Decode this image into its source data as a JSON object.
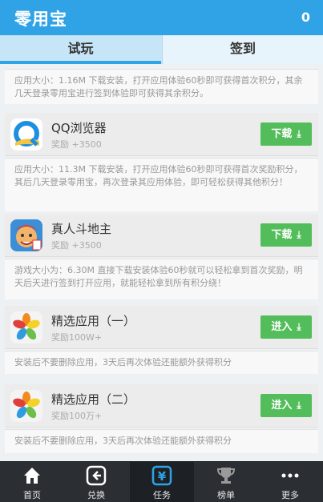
{
  "header": {
    "title": "零用宝",
    "count": "0"
  },
  "tabs": [
    {
      "label": "试玩"
    },
    {
      "label": "签到"
    }
  ],
  "top_desc": "应用大小：1.16M 下载安装，打开应用体验60秒即可获得首次积分，其余几天登录零用宝进行签到体验即可获得其余积分。",
  "apps": [
    {
      "name": "QQ浏览器",
      "reward": "奖励 +3500",
      "button": "下载",
      "icon": "qq-browser-icon",
      "desc": "应用大小：11.3M 下载安装，打开应用体验60秒即可获得首次奖励积分，其后几天登录零用宝，再次登录其应用体验，即可轻松获得其他积分！"
    },
    {
      "name": "真人斗地主",
      "reward": "奖励 +3500",
      "button": "下载",
      "icon": "doudizhu-icon",
      "desc": "游戏大小为：6.30M 直接下载安装体验60秒就可以轻松拿到首次奖励，明天后天进行签到打开应用，就能轻松拿到所有积分绕！"
    },
    {
      "name": "精选应用（一）",
      "reward": "奖励100W+",
      "button": "进入",
      "icon": "petal-app-icon",
      "desc": "安装后不要删除应用，3天后再次体验还能额外获得积分"
    },
    {
      "name": "精选应用（二）",
      "reward": "奖励100万+",
      "button": "进入",
      "icon": "petal-app-icon",
      "desc": "安装后不要删除应用，3天后再次体验还能额外获得积分"
    }
  ],
  "bottom_nav": [
    {
      "label": "首页",
      "icon": "home-icon"
    },
    {
      "label": "兑换",
      "icon": "exchange-icon"
    },
    {
      "label": "任务",
      "icon": "task-yen-icon",
      "active": true
    },
    {
      "label": "榜单",
      "icon": "trophy-icon"
    },
    {
      "label": "更多",
      "icon": "more-dots-icon"
    }
  ],
  "colors": {
    "header": "#2fa3e6",
    "button": "#52bd5a",
    "nav_bg": "#2b2f33"
  }
}
